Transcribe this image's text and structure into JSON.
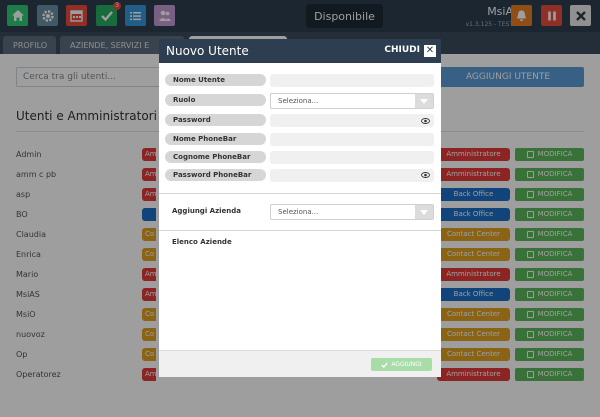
{
  "topbar": {
    "status": "Disponibile",
    "badge_count": "3",
    "user_name": "MsiA",
    "version": "v1.3.125 - TEST",
    "icons": [
      "home-icon",
      "gear-icon",
      "calendar-icon",
      "check-icon",
      "list-icon",
      "users-icon",
      "bell-icon",
      "pause-icon",
      "close-icon"
    ],
    "colors": {
      "home": "#2ecc71",
      "gear": "#6b8fa6",
      "calendar": "#e74c3c",
      "check": "#27ae60",
      "list": "#3498db",
      "users": "#c39bd3",
      "bell": "#e67e22",
      "pause": "#e74c3c",
      "close": "#e8e8e8"
    }
  },
  "tabs": [
    {
      "label": "PROFILO"
    },
    {
      "label": "AZIENDE, SERVIZI E"
    },
    {
      "label": ""
    }
  ],
  "main": {
    "search_placeholder": "Cerca tra gli utenti...",
    "add_user_label": "AGGIUNGI UTENTE",
    "section_title": "Utenti e Amministratori",
    "modify_label": "MODIFICA",
    "users": [
      {
        "name": "Admin",
        "role_left": "Am",
        "role_left_color": "#e23a3a",
        "role_right": "Amministratore",
        "role_right_color": "#e23a3a"
      },
      {
        "name": "amm c pb",
        "role_left": "Am",
        "role_left_color": "#e23a3a",
        "role_right": "Amministratore",
        "role_right_color": "#e23a3a"
      },
      {
        "name": "asp",
        "role_left": "Am",
        "role_left_color": "#e23a3a",
        "role_right": "Back Office",
        "role_right_color": "#1a6fc6"
      },
      {
        "name": "BO",
        "role_left": "",
        "role_left_color": "#1a6fc6",
        "role_right": "Back Office",
        "role_right_color": "#1a6fc6"
      },
      {
        "name": "Claudia",
        "role_left": "Co",
        "role_left_color": "#e0a021",
        "role_right": "Contact Center",
        "role_right_color": "#e0a021"
      },
      {
        "name": "Enrica",
        "role_left": "Co",
        "role_left_color": "#e0a021",
        "role_right": "Contact Center",
        "role_right_color": "#e0a021"
      },
      {
        "name": "Mario",
        "role_left": "Am",
        "role_left_color": "#e23a3a",
        "role_right": "Amministratore",
        "role_right_color": "#e23a3a"
      },
      {
        "name": "MsiAS",
        "role_left": "Am",
        "role_left_color": "#e23a3a",
        "role_right": "Back Office",
        "role_right_color": "#1a6fc6"
      },
      {
        "name": "MsiO",
        "role_left": "Co",
        "role_left_color": "#e0a021",
        "role_right": "Contact Center",
        "role_right_color": "#e0a021"
      },
      {
        "name": "nuovoz",
        "role_left": "Co",
        "role_left_color": "#e0a021",
        "role_right": "Contact Center",
        "role_right_color": "#e0a021"
      },
      {
        "name": "Op",
        "role_left": "Co",
        "role_left_color": "#e0a021",
        "role_right": "Contact Center",
        "role_right_color": "#e0a021"
      },
      {
        "name": "Operatorez",
        "role_left": "Am",
        "role_left_color": "#e23a3a",
        "role_right": "Amministratore",
        "role_right_color": "#e23a3a"
      }
    ]
  },
  "modal": {
    "title": "Nuovo Utente",
    "close_label": "CHIUDI",
    "fields": {
      "nome_utente": "Nome Utente",
      "ruolo": "Ruolo",
      "password": "Password",
      "nome_phonebar": "Nome PhoneBar",
      "cognome_phonebar": "Cognome PhoneBar",
      "password_phonebar": "Password PhoneBar"
    },
    "ruolo_select": "Seleziona...",
    "aggiungi_azienda_label": "Aggiungi Azienda",
    "azienda_select": "Seleziona...",
    "elenco_aziende_label": "Elenco Aziende",
    "add_button": "AGGIUNGI"
  }
}
